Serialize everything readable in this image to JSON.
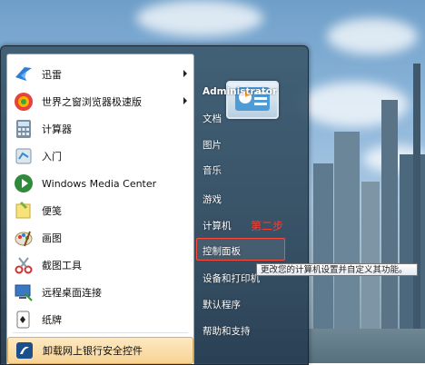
{
  "start_menu": {
    "programs": [
      {
        "label": "迅雷",
        "icon": "xunlei-bird-icon",
        "has_submenu": true
      },
      {
        "label": "世界之窗浏览器极速版",
        "icon": "browser-globe-icon",
        "has_submenu": true
      },
      {
        "label": "计算器",
        "icon": "calculator-icon",
        "has_submenu": false
      },
      {
        "label": "入门",
        "icon": "getting-started-icon",
        "has_submenu": false
      },
      {
        "label": "Windows Media Center",
        "icon": "media-center-icon",
        "has_submenu": false
      },
      {
        "label": "便笺",
        "icon": "sticky-notes-icon",
        "has_submenu": false
      },
      {
        "label": "画图",
        "icon": "paint-icon",
        "has_submenu": false
      },
      {
        "label": "截图工具",
        "icon": "snipping-tool-icon",
        "has_submenu": false
      },
      {
        "label": "远程桌面连接",
        "icon": "remote-desktop-icon",
        "has_submenu": false
      },
      {
        "label": "纸牌",
        "icon": "solitaire-icon",
        "has_submenu": false
      },
      {
        "label": "卸载网上银行安全控件",
        "icon": "uninstall-bank-icon",
        "has_submenu": false
      }
    ],
    "right_items": [
      {
        "label": "Administrator"
      },
      {
        "label": "文档"
      },
      {
        "label": "图片"
      },
      {
        "label": "音乐"
      },
      {
        "label": "游戏"
      },
      {
        "label": "计算机"
      },
      {
        "label": "控制面板"
      },
      {
        "label": "设备和打印机"
      },
      {
        "label": "默认程序"
      },
      {
        "label": "帮助和支持"
      }
    ],
    "user_picture_icon": "control-panel-picture-icon"
  },
  "annotation": {
    "step_text": "第二步",
    "highlight_color": "#ff3b2f"
  },
  "tooltip": {
    "text": "更改您的计算机设置并自定义其功能。"
  }
}
